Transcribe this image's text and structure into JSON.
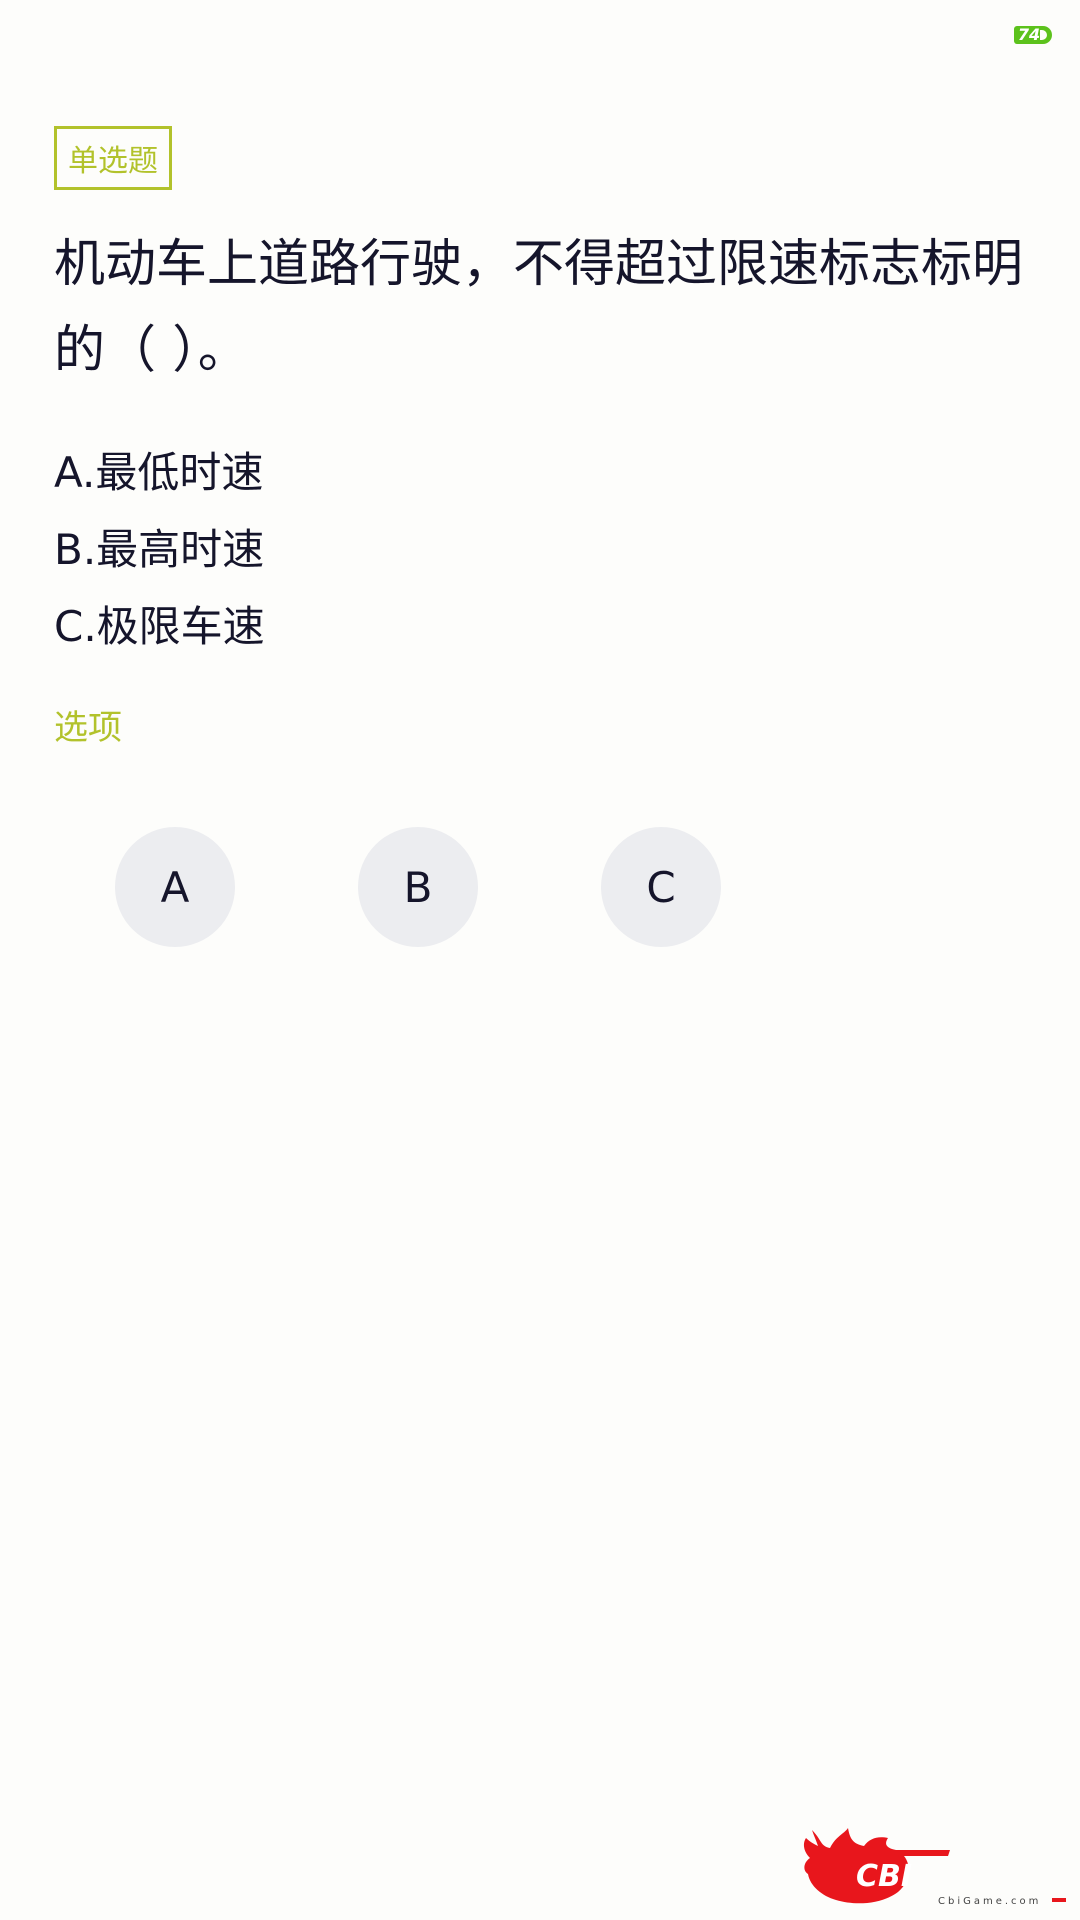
{
  "status_bar": {
    "battery_level": "74",
    "battery_color": "#5cc21c"
  },
  "question": {
    "type_label": "单选题",
    "text": "机动车上道路行驶，不得超过限速标志标明的（ ）。",
    "options": [
      {
        "label": "A.最低时速"
      },
      {
        "label": "B.最高时速"
      },
      {
        "label": "C.极限车速"
      }
    ]
  },
  "answer_section": {
    "label": "选项",
    "buttons": [
      {
        "label": "A"
      },
      {
        "label": "B"
      },
      {
        "label": "C"
      }
    ]
  },
  "watermark": {
    "logo_text": "CBI",
    "site_text": "CbiGame.com"
  },
  "colors": {
    "accent": "#b2c22b",
    "text": "#15152b",
    "button_bg": "#ecedf0",
    "background": "#fdfdfb",
    "watermark_red": "#e8161c"
  }
}
